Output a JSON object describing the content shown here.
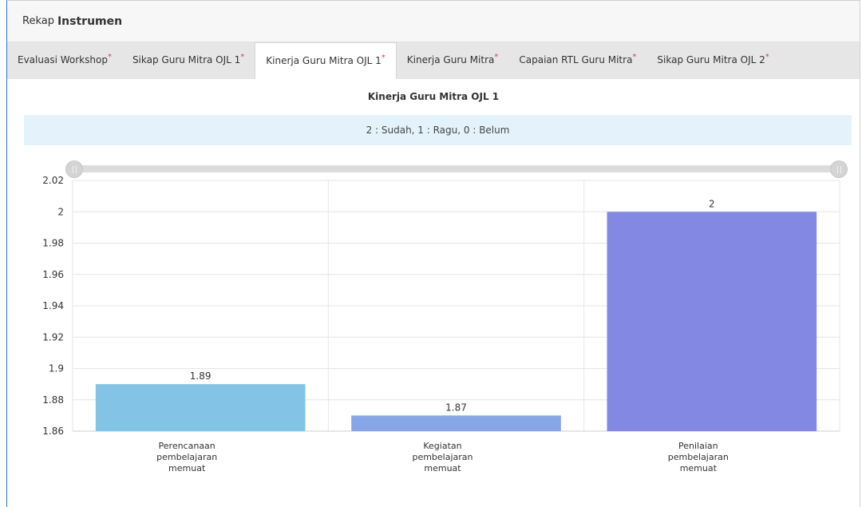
{
  "header": {
    "prefix": "Rekap",
    "title": "Instrumen"
  },
  "tabs": [
    {
      "label": "Evaluasi Workshop",
      "asterisk": "*",
      "active": false
    },
    {
      "label": "Sikap Guru Mitra OJL 1",
      "asterisk": "*",
      "active": false
    },
    {
      "label": "Kinerja Guru Mitra OJL 1",
      "asterisk": "*",
      "active": true
    },
    {
      "label": "Kinerja Guru Mitra",
      "asterisk": "*",
      "active": false
    },
    {
      "label": "Capaian RTL Guru Mitra",
      "asterisk": "*",
      "active": false
    },
    {
      "label": "Sikap Guru Mitra OJL 2",
      "asterisk": "*",
      "active": false
    }
  ],
  "legend_text": "2 : Sudah, 1 : Ragu, 0 : Belum",
  "colors": {
    "bar1": "#82c3e6",
    "bar2": "#88a6e6",
    "bar3": "#8389e3",
    "accent": "#2a6fd6",
    "legend_bg": "#e4f3fb"
  },
  "chart_data": {
    "type": "bar",
    "title": "Kinerja Guru Mitra OJL 1",
    "categories": [
      [
        "Perencanaan",
        "pembelajaran",
        "memuat"
      ],
      [
        "Kegiatan",
        "pembelajaran",
        "memuat"
      ],
      [
        "Penilaian",
        "pembelajaran",
        "memuat"
      ]
    ],
    "values": [
      1.89,
      1.87,
      2
    ],
    "value_labels": [
      "1.89",
      "1.87",
      "2"
    ],
    "ylim": [
      1.86,
      2.02
    ],
    "yticks": [
      "1.86",
      "1.88",
      "1.9",
      "1.92",
      "1.94",
      "1.96",
      "1.98",
      "2",
      "2.02"
    ],
    "grid": true,
    "xlabel": "",
    "ylabel": ""
  }
}
